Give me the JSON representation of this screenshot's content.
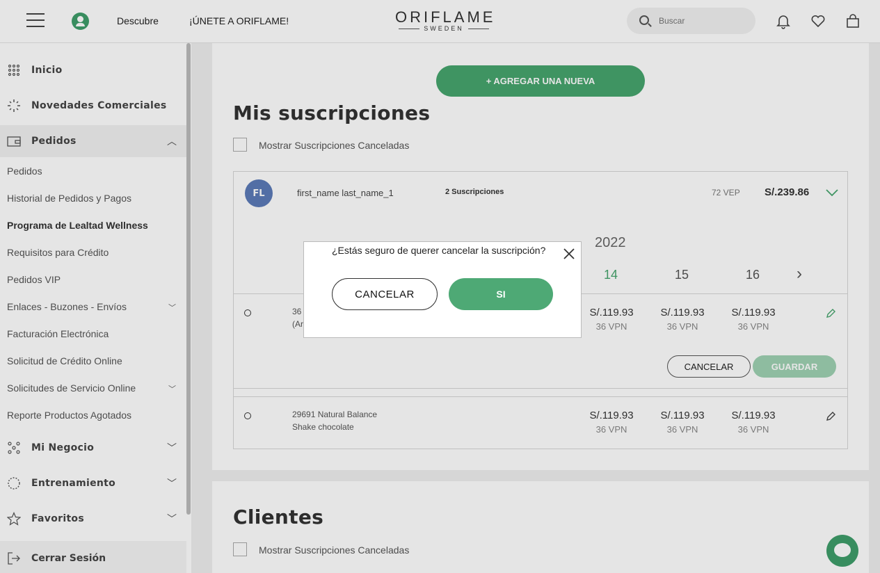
{
  "header": {
    "discover_label": "Descubre",
    "join_label": "¡ÚNETE A ORIFLAME!",
    "logo_main": "ORIFLAME",
    "logo_sub": "SWEDEN",
    "search_placeholder": "Buscar"
  },
  "sidebar": {
    "main_items": [
      {
        "label": "Inicio"
      },
      {
        "label": "Novedades Comerciales"
      },
      {
        "label": "Pedidos"
      },
      {
        "label": "Mi Negocio"
      },
      {
        "label": "Entrenamiento"
      },
      {
        "label": "Favoritos"
      },
      {
        "label": "Cerrar Sesión"
      }
    ],
    "sub_items": [
      {
        "label": "Pedidos"
      },
      {
        "label": "Historial de Pedidos y Pagos"
      },
      {
        "label": "Programa de Lealtad Wellness"
      },
      {
        "label": "Requisitos para Crédito"
      },
      {
        "label": "Pedidos VIP"
      },
      {
        "label": "Enlaces - Buzones - Envíos"
      },
      {
        "label": "Facturación Electrónica"
      },
      {
        "label": "Solicitud de Crédito Online"
      },
      {
        "label": "Solicitudes de Servicio Online"
      },
      {
        "label": "Reporte Productos Agotados"
      }
    ]
  },
  "main": {
    "add_button": "+ AGREGAR UNA NUEVA",
    "subs_title": "Mis suscripciones",
    "show_cancelled": "Mostrar Suscripciones Canceladas",
    "clients_title": "Clientes",
    "subscription": {
      "avatar_initials": "FL",
      "name": "first_name last_name_1",
      "count": "2 Suscripciones",
      "vep": "72 VEP",
      "total": "S/.239.86",
      "year": "2022",
      "weeks": [
        "14",
        "15",
        "16"
      ],
      "next_arrow": "›",
      "rows": [
        {
          "product_line1": "36",
          "product_line2": "(Ar",
          "prices": [
            {
              "price": "S/.119.93",
              "vpn": "36 VPN"
            },
            {
              "price": "S/.119.93",
              "vpn": "36 VPN"
            },
            {
              "price": "S/.119.93",
              "vpn": "36 VPN"
            }
          ]
        },
        {
          "product_line1": "29691 Natural Balance",
          "product_line2": "Shake chocolate",
          "prices": [
            {
              "price": "S/.119.93",
              "vpn": "36 VPN"
            },
            {
              "price": "S/.119.93",
              "vpn": "36 VPN"
            },
            {
              "price": "S/.119.93",
              "vpn": "36 VPN"
            }
          ]
        }
      ],
      "cancel_label": "CANCELAR",
      "save_label": "GUARDAR"
    }
  },
  "modal": {
    "question": "¿Estás seguro de querer cancelar la suscripción?",
    "cancel_label": "CANCELAR",
    "confirm_label": "SI"
  },
  "colors": {
    "brand_green": "#47a56e",
    "avatar_blue": "#5c7bb8"
  }
}
